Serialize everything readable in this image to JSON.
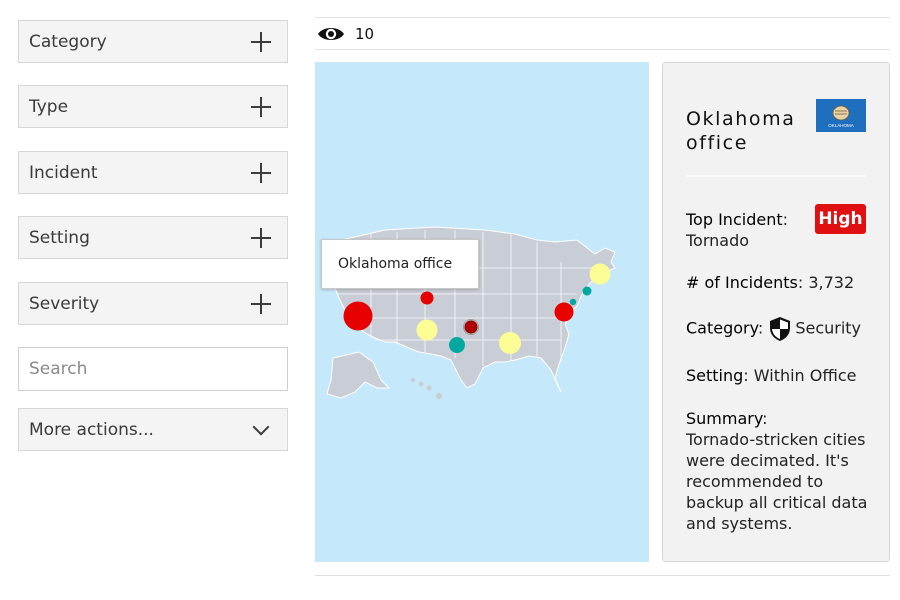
{
  "filters": [
    {
      "label": "Category"
    },
    {
      "label": "Type"
    },
    {
      "label": "Incident"
    },
    {
      "label": "Setting"
    },
    {
      "label": "Severity"
    }
  ],
  "search": {
    "placeholder": "Search",
    "value": ""
  },
  "more_actions": {
    "label": "More actions..."
  },
  "topbar": {
    "view_count": "10",
    "icon": "eye-icon"
  },
  "map": {
    "tooltip": "Oklahoma office",
    "colors": {
      "water": "#c6e8fb",
      "land": "#c9ced6",
      "red": "#e60000",
      "yellow": "#fdfd96",
      "teal": "#00a8a0"
    }
  },
  "card": {
    "title": "Oklahoma office",
    "flag_text": "OKLAHOMA",
    "top_incident_label": "Top Incident",
    "top_incident_value": "Tornado",
    "severity": "High",
    "incidents_label": "# of Incidents",
    "incidents_value": "3,732",
    "category_label": "Category",
    "category_value": "Security",
    "setting_label": "Setting",
    "setting_value": "Within Office",
    "summary_label": "Summary",
    "summary_value": "Tornado-stricken cities were decimated. It's recommended to backup all critical data and systems."
  }
}
